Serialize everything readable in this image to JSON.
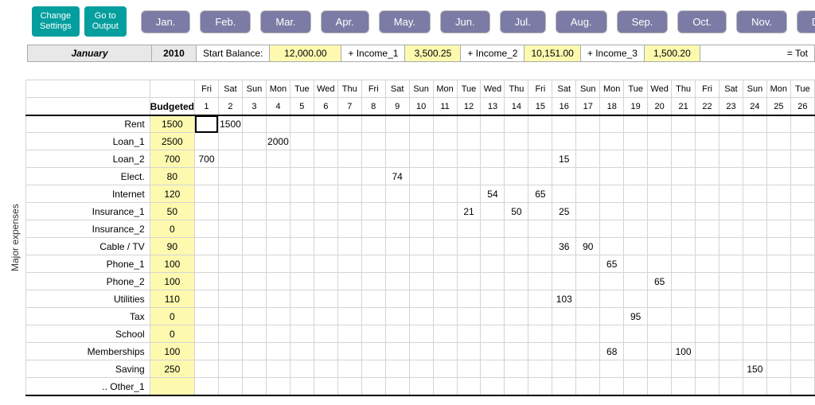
{
  "buttons": {
    "settings": "Change\nSettings",
    "output": "Go to\nOutput"
  },
  "months": [
    "Jan.",
    "Feb.",
    "Mar.",
    "Apr.",
    "May.",
    "Jun.",
    "Jul.",
    "Aug.",
    "Sep.",
    "Oct.",
    "Nov.",
    "Dec."
  ],
  "info": {
    "month": "January",
    "year": "2010",
    "start_balance_label": "Start Balance:",
    "start_balance": "12,000.00",
    "income1_label": "+ Income_1",
    "income1": "3,500.25",
    "income2_label": "+ Income_2",
    "income2": "10,151.00",
    "income3_label": "+ Income_3",
    "income3": "1,500.20",
    "total_label": "= Tot"
  },
  "section_label": "Major expenses",
  "headers": {
    "budgeted": "Budgeted"
  },
  "days": {
    "weekdays": [
      "Fri",
      "Sat",
      "Sun",
      "Mon",
      "Tue",
      "Wed",
      "Thu",
      "Fri",
      "Sat",
      "Sun",
      "Mon",
      "Tue",
      "Wed",
      "Thu",
      "Fri",
      "Sat",
      "Sun",
      "Mon",
      "Tue",
      "Wed",
      "Thu",
      "Fri",
      "Sat",
      "Sun",
      "Mon",
      "Tue"
    ],
    "numbers": [
      "1",
      "2",
      "3",
      "4",
      "5",
      "6",
      "7",
      "8",
      "9",
      "10",
      "11",
      "12",
      "13",
      "14",
      "15",
      "16",
      "17",
      "18",
      "19",
      "20",
      "21",
      "22",
      "23",
      "24",
      "25",
      "26"
    ]
  },
  "rows": [
    {
      "name": "Rent",
      "budget": "1500",
      "cells": {
        "2": "1500"
      }
    },
    {
      "name": "Loan_1",
      "budget": "2500",
      "cells": {
        "4": "2000"
      }
    },
    {
      "name": "Loan_2",
      "budget": "700",
      "cells": {
        "1": "700",
        "16": "15"
      }
    },
    {
      "name": "Elect.",
      "budget": "80",
      "cells": {
        "9": "74"
      }
    },
    {
      "name": "Internet",
      "budget": "120",
      "cells": {
        "13": "54",
        "15": "65"
      }
    },
    {
      "name": "Insurance_1",
      "budget": "50",
      "cells": {
        "12": "21",
        "14": "50",
        "16": "25"
      }
    },
    {
      "name": "Insurance_2",
      "budget": "0",
      "cells": {}
    },
    {
      "name": "Cable / TV",
      "budget": "90",
      "cells": {
        "16": "36",
        "17": "90"
      }
    },
    {
      "name": "Phone_1",
      "budget": "100",
      "cells": {
        "18": "65"
      }
    },
    {
      "name": "Phone_2",
      "budget": "100",
      "cells": {
        "20": "65"
      }
    },
    {
      "name": "Utilities",
      "budget": "110",
      "cells": {
        "16": "103"
      }
    },
    {
      "name": "Tax",
      "budget": "0",
      "cells": {
        "19": "95"
      }
    },
    {
      "name": "School",
      "budget": "0",
      "cells": {}
    },
    {
      "name": "Memberships",
      "budget": "100",
      "cells": {
        "18": "68",
        "21": "100"
      }
    },
    {
      "name": "Saving",
      "budget": "250",
      "cells": {
        "24": "150"
      }
    },
    {
      "name": ".. Other_1",
      "budget": "",
      "cells": {}
    }
  ],
  "selected_cell": {
    "row": 0,
    "day": "1"
  }
}
